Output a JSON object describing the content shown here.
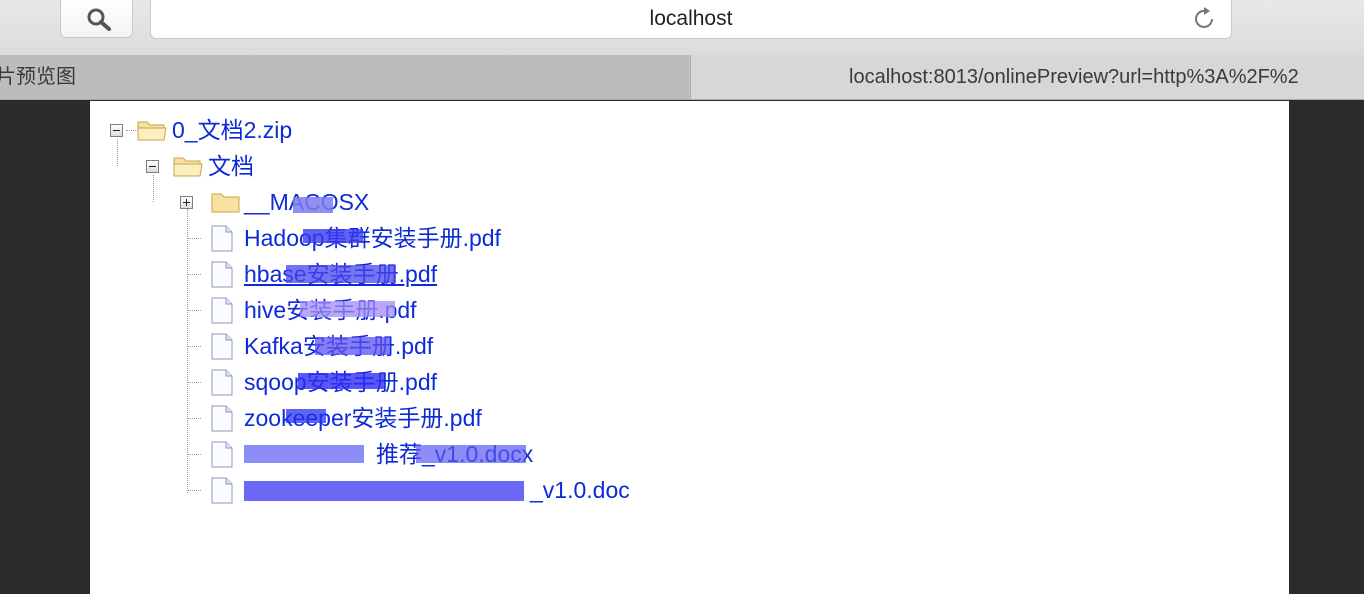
{
  "toolbar": {
    "address": "localhost",
    "search_icon": "magnifier-icon",
    "reload_icon": "reload-icon"
  },
  "tabs": [
    {
      "label": "片预览图"
    },
    {
      "label": "localhost:8013/onlinePreview?url=http%3A%2F%2"
    }
  ],
  "tree": {
    "root": {
      "label": "0_文档2.zip"
    },
    "folder": {
      "label": "文档"
    },
    "items": [
      {
        "label": "__MACOSX",
        "type": "folder"
      },
      {
        "label": "Hadoop集群安装手册.pdf",
        "type": "file"
      },
      {
        "label": "hbase安装手册.pdf",
        "type": "file"
      },
      {
        "label": "hive安装手册.pdf",
        "type": "file"
      },
      {
        "label": "Kafka安装手册.pdf",
        "type": "file"
      },
      {
        "label": "sqoop安装手册.pdf",
        "type": "file"
      },
      {
        "label": "zookeeper安装手册.pdf",
        "type": "file"
      },
      {
        "label": "推荐_v1.0.docx",
        "type": "file"
      },
      {
        "label": "_v1.0.doc",
        "type": "file"
      }
    ]
  },
  "colors": {
    "link": "#0c2ad8",
    "page_bg": "#ffffff",
    "side_bg": "#2b2b2b"
  }
}
